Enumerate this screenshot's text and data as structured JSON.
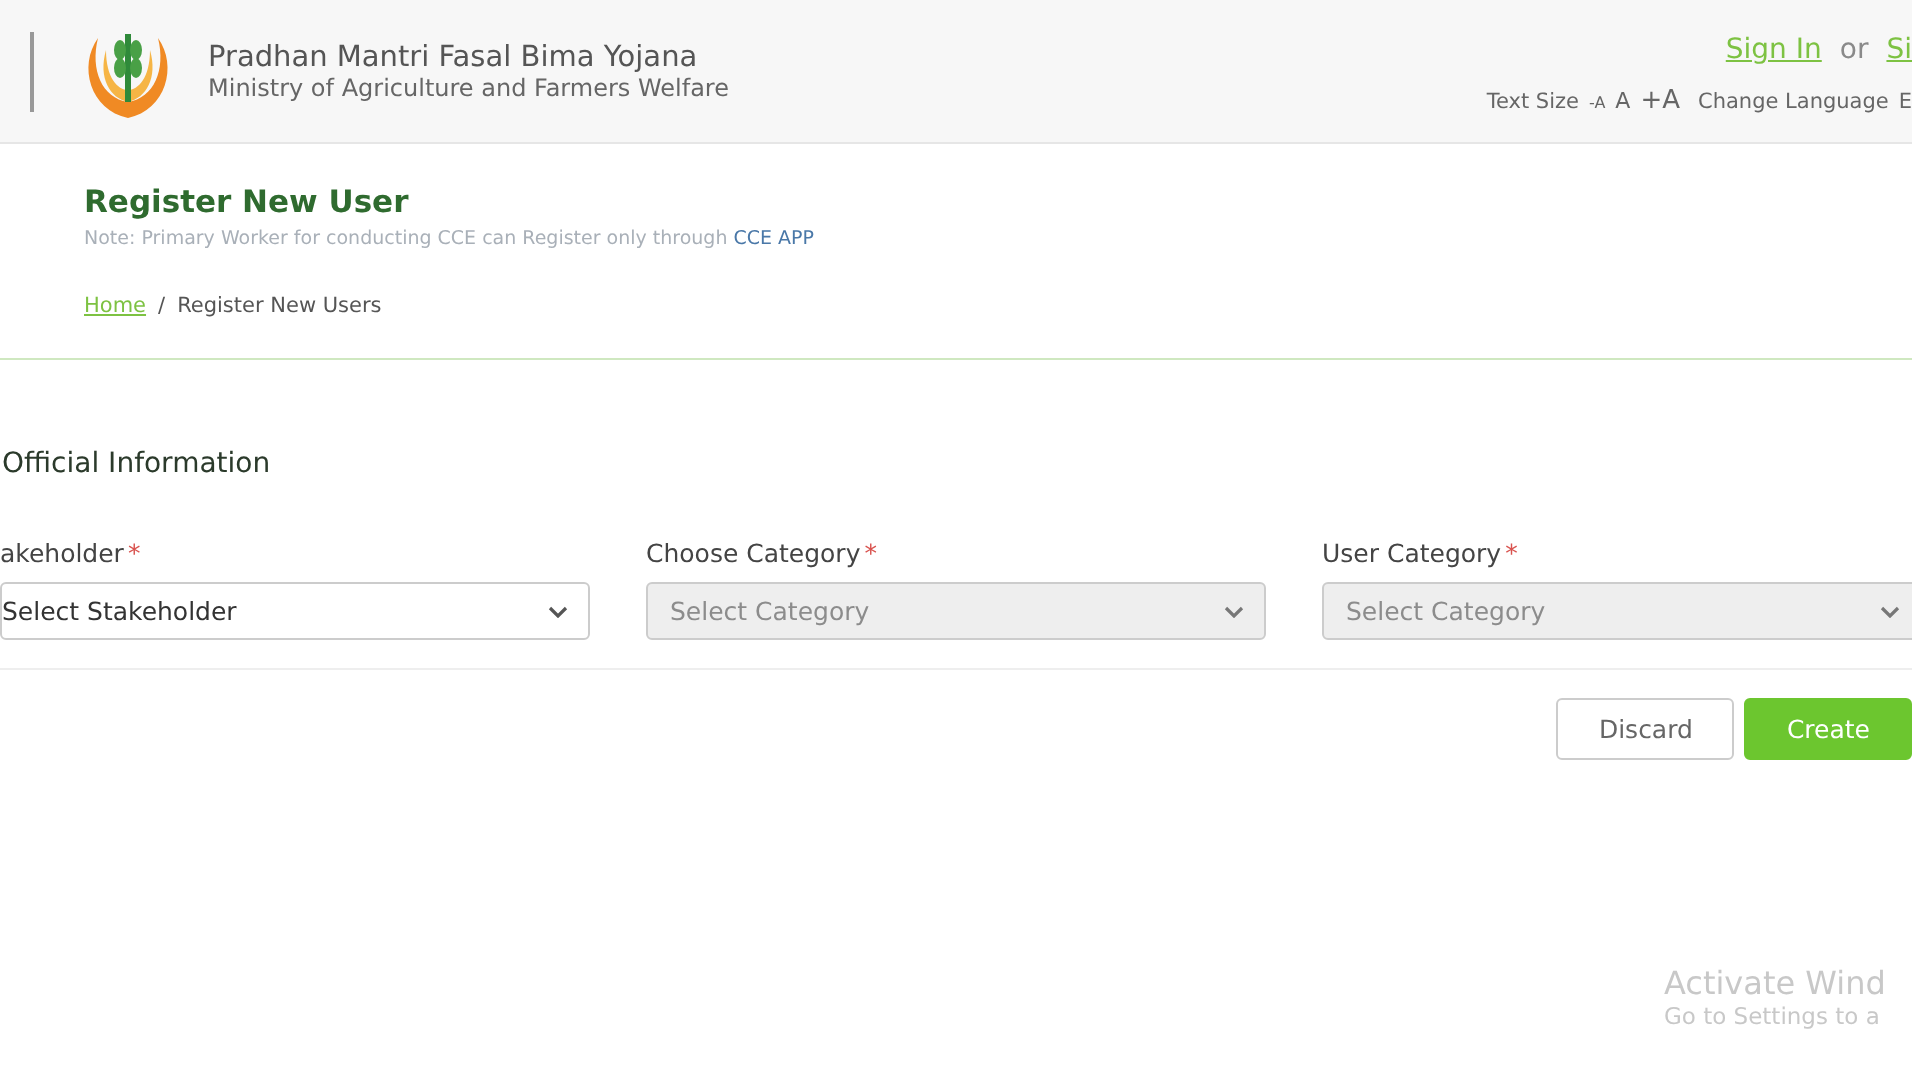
{
  "header": {
    "title": "Pradhan Mantri Fasal Bima Yojana",
    "subtitle": "Ministry of Agriculture and Farmers Welfare",
    "auth": [
      {
        "label": "Sign In",
        "kind": "link"
      },
      {
        "label": "or",
        "kind": "text"
      },
      {
        "label": "Si",
        "kind": "link"
      }
    ],
    "text_size": {
      "label": "Text Size",
      "options": [
        {
          "label": "-A"
        },
        {
          "label": "A"
        },
        {
          "label": "+A"
        }
      ]
    },
    "language": {
      "label": "Change Language",
      "value": "E"
    }
  },
  "page": {
    "title": "Register New User",
    "note": "Note: Primary Worker for conducting CCE can Register only through",
    "note_link": "CCE APP",
    "breadcrumb_separator": "/",
    "breadcrumb": [
      {
        "label": "Home",
        "kind": "link"
      },
      {
        "label": "Register New Users",
        "kind": "current"
      }
    ]
  },
  "form": {
    "section": "Official Information",
    "required_mark": "*",
    "fields": [
      {
        "label": "akeholder",
        "required": true,
        "value": "Select Stakeholder",
        "disabled": false
      },
      {
        "label": "Choose Category",
        "required": true,
        "placeholder": "Select Category",
        "disabled": true
      },
      {
        "label": "User Category",
        "required": true,
        "placeholder": "Select Category",
        "disabled": true
      }
    ],
    "buttons": [
      {
        "label": "Discard",
        "kind": "secondary"
      },
      {
        "label": "Create",
        "kind": "primary"
      }
    ]
  },
  "os_notice": {
    "title": "Activate Wind",
    "text": "Go to Settings to a"
  }
}
